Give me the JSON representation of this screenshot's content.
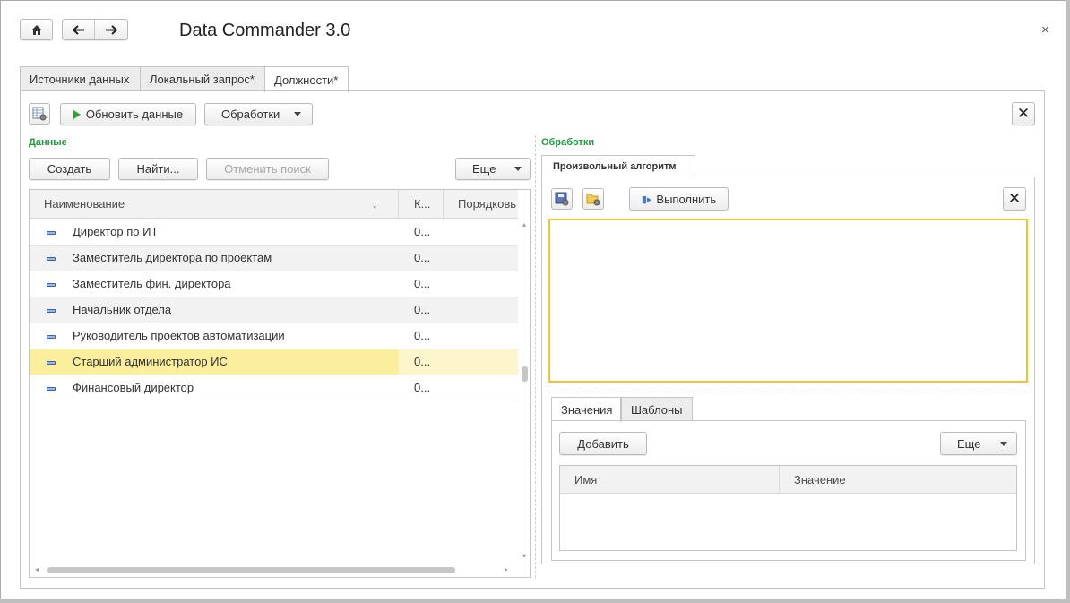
{
  "app": {
    "title": "Data Commander 3.0",
    "close_glyph": "×"
  },
  "nav": {
    "home_icon": "home-icon",
    "back_icon": "arrow-left-icon",
    "forward_icon": "arrow-right-icon"
  },
  "tabs": [
    {
      "label": "Источники данных",
      "active": false
    },
    {
      "label": "Локальный запрос*",
      "active": false
    },
    {
      "label": "Должности*",
      "active": true
    }
  ],
  "toolbar": {
    "refresh_label": "Обновить данные",
    "processing_label": "Обработки",
    "close_glyph": "✕"
  },
  "data_group": {
    "title": "Данные",
    "create_label": "Создать",
    "find_label": "Найти...",
    "cancel_search_label": "Отменить поиск",
    "more_label": "Еще",
    "columns": {
      "name": "Наименование",
      "sort_glyph": "↓",
      "k": "К...",
      "order": "Порядковь"
    },
    "rows": [
      {
        "name": "Директор по ИТ",
        "k": "0...",
        "selected": false
      },
      {
        "name": "Заместитель директора по проектам",
        "k": "0...",
        "selected": false
      },
      {
        "name": "Заместитель фин. директора",
        "k": "0...",
        "selected": false
      },
      {
        "name": "Начальник отдела",
        "k": "0...",
        "selected": false
      },
      {
        "name": "Руководитель проектов автоматизации",
        "k": "0...",
        "selected": false
      },
      {
        "name": "Старший администратор ИС",
        "k": "0...",
        "selected": true
      },
      {
        "name": "Финансовый директор",
        "k": "0...",
        "selected": false
      }
    ]
  },
  "processing_group": {
    "title": "Обработки",
    "tab_label": "Произвольный алгоритм",
    "run_label": "Выполнить",
    "close_glyph": "✕",
    "editor_text": "",
    "subtabs": [
      {
        "label": "Значения",
        "active": true
      },
      {
        "label": "Шаблоны",
        "active": false
      }
    ],
    "add_label": "Добавить",
    "more_label": "Еще",
    "columns": {
      "name": "Имя",
      "value": "Значение"
    }
  },
  "colors": {
    "group_title": "#1f9a3f",
    "selected_row": "#fbee9c",
    "editor_border": "#f2c42c"
  }
}
